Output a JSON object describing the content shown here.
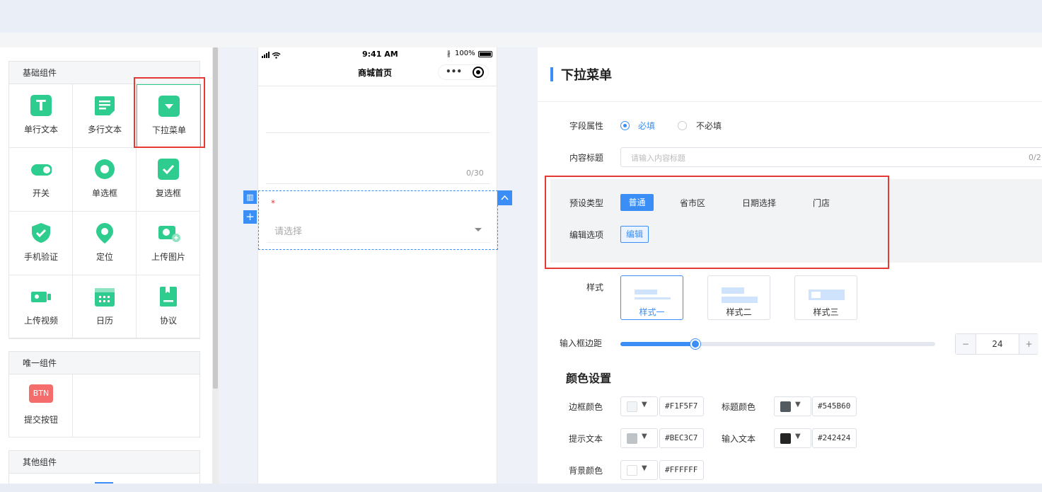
{
  "left_panel": {
    "basic_group": {
      "title": "基础组件",
      "items": [
        {
          "label": "单行文本",
          "icon": "text-t-icon"
        },
        {
          "label": "多行文本",
          "icon": "multiline-text-icon"
        },
        {
          "label": "下拉菜单",
          "icon": "dropdown-icon"
        },
        {
          "label": "开关",
          "icon": "toggle-icon"
        },
        {
          "label": "单选框",
          "icon": "radio-icon"
        },
        {
          "label": "复选框",
          "icon": "checkbox-icon"
        },
        {
          "label": "手机验证",
          "icon": "shield-check-icon"
        },
        {
          "label": "定位",
          "icon": "location-pin-icon"
        },
        {
          "label": "上传图片",
          "icon": "camera-icon"
        },
        {
          "label": "上传视频",
          "icon": "video-icon"
        },
        {
          "label": "日历",
          "icon": "calendar-icon"
        },
        {
          "label": "协议",
          "icon": "agreement-icon"
        }
      ]
    },
    "unique_group": {
      "title": "唯一组件",
      "items": [
        {
          "label": "提交按钮",
          "badge": "BTN"
        }
      ]
    },
    "other_group": {
      "title": "其他组件"
    }
  },
  "phone": {
    "status_time": "9:41 AM",
    "status_battery": "100%",
    "title": "商城首页",
    "counter": "0/30",
    "required_mark": "*",
    "select_placeholder": "请选择"
  },
  "right_panel": {
    "title": "下拉菜单",
    "field_attr": {
      "label": "字段属性",
      "options": [
        "必填",
        "不必填"
      ],
      "selected": "必填"
    },
    "content_title": {
      "label": "内容标题",
      "placeholder": "请输入内容标题",
      "counter": "0/2"
    },
    "preset_type": {
      "label": "预设类型",
      "options": [
        "普通",
        "省市区",
        "日期选择",
        "门店"
      ],
      "selected": "普通"
    },
    "edit_options": {
      "label": "编辑选项",
      "button": "编辑"
    },
    "style": {
      "label": "样式",
      "options": [
        "样式一",
        "样式二",
        "样式三"
      ],
      "selected": "样式一"
    },
    "input_padding": {
      "label": "输入框边距",
      "value": "24",
      "minus": "−",
      "plus": "+",
      "slider_fraction": 0.24
    },
    "color_settings": {
      "heading": "颜色设置",
      "border_color": {
        "label": "边框颜色",
        "hex": "#F1F5F7"
      },
      "title_color": {
        "label": "标题颜色",
        "hex": "#545B60"
      },
      "hint_text": {
        "label": "提示文本",
        "hex": "#BEC3C7"
      },
      "input_text": {
        "label": "输入文本",
        "hex": "#242424"
      },
      "bg_color": {
        "label": "背景颜色",
        "hex": "#FFFFFF"
      }
    }
  },
  "colors": {
    "accent": "#3a8ef6",
    "green": "#2ecc8e",
    "highlight_red": "#e53935"
  }
}
